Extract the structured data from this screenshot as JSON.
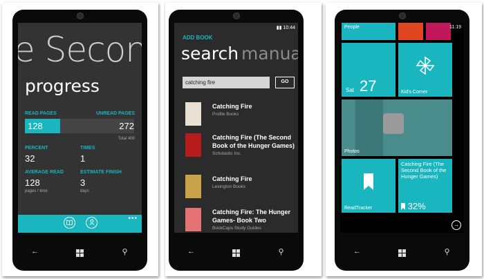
{
  "phone1": {
    "title": "e Second",
    "subtitle": "progress",
    "read_pages_label": "READ PAGES",
    "read_pages_value": "128",
    "unread_pages_label": "UNREAD PAGES",
    "unread_pages_value": "272",
    "total_label": "Total 400",
    "progress_fraction": 0.32,
    "percent_label": "PERCENT",
    "percent_value": "32",
    "times_label": "TIMES",
    "times_value": "1",
    "average_read_label": "AVERAGE READ",
    "average_read_value": "128",
    "average_read_unit": "pages / time",
    "estimate_finish_label": "ESTIMATE FINISH",
    "estimate_finish_value": "3",
    "estimate_finish_unit": "days",
    "appbar_more": "•••",
    "accent": "#19b6c0"
  },
  "phone2": {
    "time": "10:44",
    "app_title": "ADD BOOK",
    "pivot_active": "search",
    "pivot_inactive": "manual",
    "search_value": "catching fire",
    "go_label": "GO",
    "books": [
      {
        "title": "Catching Fire",
        "publisher": "Profile Books",
        "cover_color": "#e8e0d0"
      },
      {
        "title": "Catching Fire (The Second Book of the Hunger Games)",
        "publisher": "Scholastic Inc.",
        "cover_color": "#b71c1c"
      },
      {
        "title": "Catching Fire",
        "publisher": "Lexington Books",
        "cover_color": "#c9a24a"
      },
      {
        "title": "Catching Fire: The Hunger Games- Book Two",
        "publisher": "BookCaps Study Guides",
        "cover_color": "#e57373"
      }
    ]
  },
  "phone3": {
    "time": "11:19",
    "people_label": "People",
    "cal_day": "Sat",
    "cal_num": "27",
    "kids_label": "Kid's Corner",
    "photos_label": "Photos",
    "readtracker_label": "ReadTracker",
    "book_tile_title": "Catching Fire (The Second Book of the Hunger Games)",
    "book_tile_pct": "32%"
  }
}
